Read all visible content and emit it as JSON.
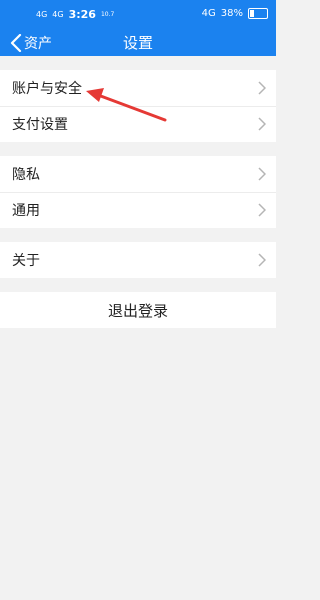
{
  "status_bar": {
    "signal_1": "4G",
    "signal_2": "4G",
    "time": "3:26",
    "speed": "10.7",
    "network": "4G",
    "battery": "38%"
  },
  "nav": {
    "back_label": "资产",
    "title": "设置"
  },
  "groups": [
    {
      "items": [
        {
          "label": "账户与安全"
        },
        {
          "label": "支付设置"
        }
      ]
    },
    {
      "items": [
        {
          "label": "隐私"
        },
        {
          "label": "通用"
        }
      ]
    },
    {
      "items": [
        {
          "label": "关于"
        }
      ]
    }
  ],
  "logout_label": "退出登录",
  "colors": {
    "header": "#1b82ef",
    "annotation_arrow": "#e53935"
  }
}
